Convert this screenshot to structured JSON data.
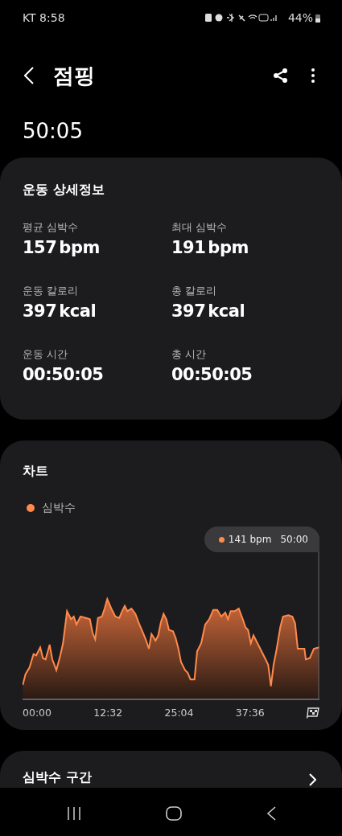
{
  "status_bar": {
    "carrier_time": "KT 8:58",
    "battery": "44%"
  },
  "header": {
    "title": "점핑"
  },
  "duration": "50:05",
  "details": {
    "title": "운동 상세정보",
    "stats": [
      {
        "label": "평균 심박수",
        "value": "157",
        "unit": "bpm"
      },
      {
        "label": "최대 심박수",
        "value": "191",
        "unit": "bpm"
      },
      {
        "label": "운동 칼로리",
        "value": "397",
        "unit": "kcal"
      },
      {
        "label": "총 칼로리",
        "value": "397",
        "unit": "kcal"
      },
      {
        "label": "운동 시간",
        "value": "00:50:05"
      },
      {
        "label": "총 시간",
        "value": "00:50:05"
      }
    ]
  },
  "chart": {
    "title": "차트",
    "legend": "심박수",
    "tooltip": {
      "value": "141 bpm",
      "time": "50:00"
    },
    "x_labels": [
      "00:00",
      "12:32",
      "25:04",
      "37:36"
    ]
  },
  "zones": {
    "title": "심박수 구간"
  }
}
